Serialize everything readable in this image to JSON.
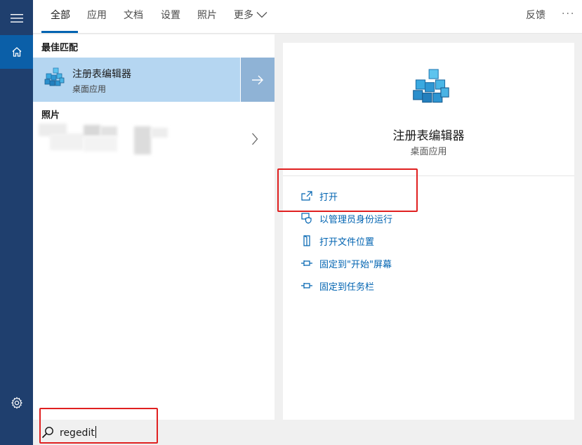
{
  "tabs": [
    {
      "label": "全部",
      "active": true
    },
    {
      "label": "应用",
      "active": false
    },
    {
      "label": "文档",
      "active": false
    },
    {
      "label": "设置",
      "active": false
    },
    {
      "label": "照片",
      "active": false
    },
    {
      "label": "更多",
      "active": false
    }
  ],
  "topbar": {
    "feedback_label": "反馈",
    "more_options": "···"
  },
  "best_match": {
    "section_label": "最佳匹配",
    "app_name": "注册表编辑器",
    "app_type": "桌面应用"
  },
  "photos": {
    "section_label": "照片"
  },
  "detail": {
    "app_name": "注册表编辑器",
    "app_type": "桌面应用",
    "actions": [
      {
        "label": "打开",
        "icon": "open-external-icon"
      },
      {
        "label": "以管理员身份运行",
        "icon": "admin-shield-icon"
      },
      {
        "label": "打开文件位置",
        "icon": "file-location-icon"
      },
      {
        "label": "固定到\"开始\"屏幕",
        "icon": "pin-icon"
      },
      {
        "label": "固定到任务栏",
        "icon": "pin-icon"
      }
    ]
  },
  "search": {
    "query": "regedit"
  },
  "colors": {
    "rail": "#1f3f6e",
    "home_active": "#0b5fa8",
    "accent": "#0063b1",
    "best_match_bg": "#b5d6f1",
    "annotation_red": "#e02020"
  }
}
